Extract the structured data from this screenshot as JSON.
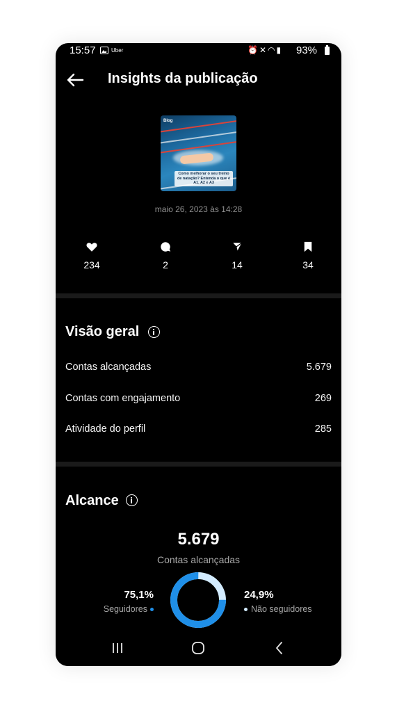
{
  "status_bar": {
    "time": "15:57",
    "app_label": "Uber",
    "battery": "93%",
    "icons": [
      "alarm-icon",
      "mute-icon",
      "wifi-icon",
      "signal-icon",
      "battery-icon"
    ]
  },
  "header": {
    "title": "Insights da publicação"
  },
  "post": {
    "thumbnail_tag": "Blog",
    "thumbnail_caption": "Como melhorar o seu treino de natação? Entenda o que é A1, A2 e A3",
    "date": "maio 26, 2023 às 14:28"
  },
  "stats": [
    {
      "icon": "heart-icon",
      "value": "234"
    },
    {
      "icon": "comment-icon",
      "value": "2"
    },
    {
      "icon": "share-icon",
      "value": "14"
    },
    {
      "icon": "bookmark-icon",
      "value": "34"
    }
  ],
  "overview": {
    "title": "Visão geral",
    "rows": [
      {
        "label": "Contas alcançadas",
        "value": "5.679"
      },
      {
        "label": "Contas com engajamento",
        "value": "269"
      },
      {
        "label": "Atividade do perfil",
        "value": "285"
      }
    ]
  },
  "reach": {
    "title": "Alcance",
    "total": "5.679",
    "total_label": "Contas alcançadas",
    "followers_pct": "75,1%",
    "followers_label": "Seguidores",
    "followers_fraction": 0.751,
    "non_followers_pct": "24,9%",
    "non_followers_label": "Não seguidores",
    "followers_color": "#1f8fe8",
    "non_followers_color": "#d3ecff"
  },
  "colors": {
    "background": "#000000",
    "divider": "#1a1a1a",
    "muted_text": "#a8a8a8"
  }
}
